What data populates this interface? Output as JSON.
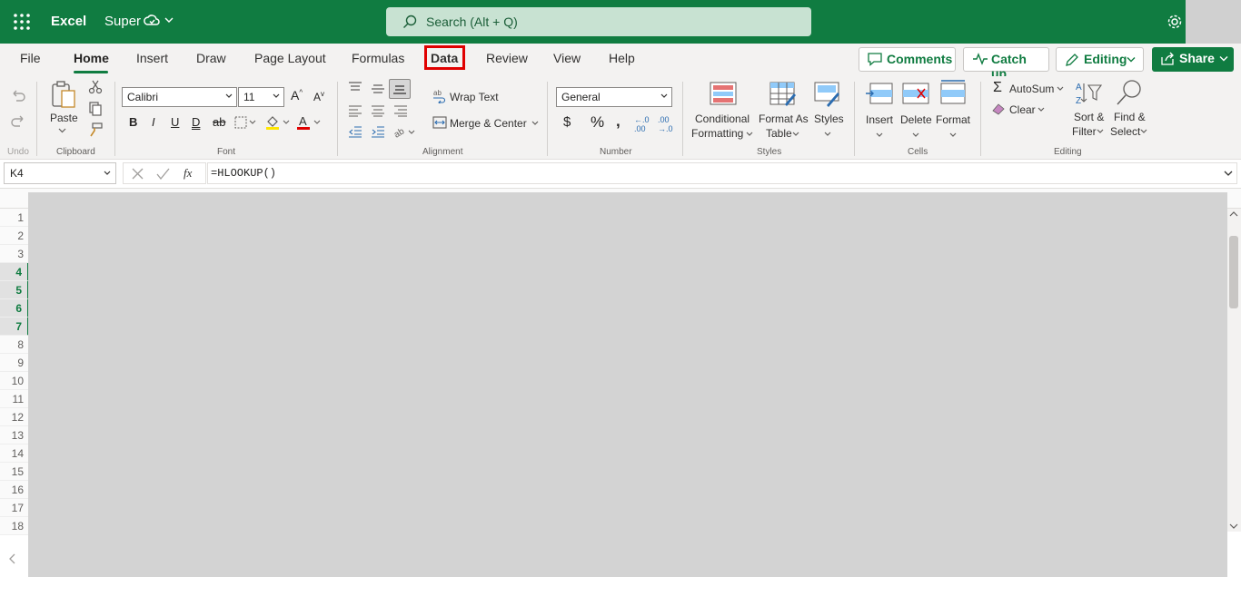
{
  "title_bar": {
    "app_name": "Excel",
    "document_name": "Super",
    "search_placeholder": "Search (Alt + Q)"
  },
  "tabs": {
    "items": [
      "File",
      "Home",
      "Insert",
      "Draw",
      "Page Layout",
      "Formulas",
      "Data",
      "Review",
      "View",
      "Help"
    ],
    "active": "Home",
    "highlighted": "Data"
  },
  "top_actions": {
    "comments": "Comments",
    "catch_up": "Catch up",
    "editing": "Editing",
    "share": "Share"
  },
  "ribbon": {
    "undo_group": "Undo",
    "clipboard": {
      "label": "Clipboard",
      "paste": "Paste"
    },
    "font": {
      "label": "Font",
      "font_name": "Calibri",
      "font_size": "11"
    },
    "alignment": {
      "label": "Alignment",
      "wrap_text": "Wrap Text",
      "merge_center": "Merge & Center"
    },
    "number": {
      "label": "Number",
      "format": "General"
    },
    "styles": {
      "label": "Styles",
      "conditional_1": "Conditional",
      "conditional_2": "Formatting",
      "format_as_1": "Format As",
      "format_as_2": "Table",
      "styles": "Styles"
    },
    "cells": {
      "label": "Cells",
      "insert": "Insert",
      "delete": "Delete",
      "format": "Format"
    },
    "editing": {
      "label": "Editing",
      "autosum": "AutoSum",
      "clear": "Clear",
      "sort_1": "Sort &",
      "sort_2": "Filter",
      "find_1": "Find &",
      "find_2": "Select"
    }
  },
  "formula_bar": {
    "name_box": "K4",
    "formula": "=HLOOKUP()"
  },
  "grid": {
    "rows": [
      "1",
      "2",
      "3",
      "4",
      "5",
      "6",
      "7",
      "8",
      "9",
      "10",
      "11",
      "12",
      "13",
      "14",
      "15",
      "16",
      "17",
      "18"
    ],
    "selected_rows": [
      "4",
      "5",
      "6",
      "7"
    ]
  },
  "colors": {
    "brand_green": "#107c41",
    "highlight_red": "#e00000",
    "overlay_gray": "#d3d3d3"
  }
}
